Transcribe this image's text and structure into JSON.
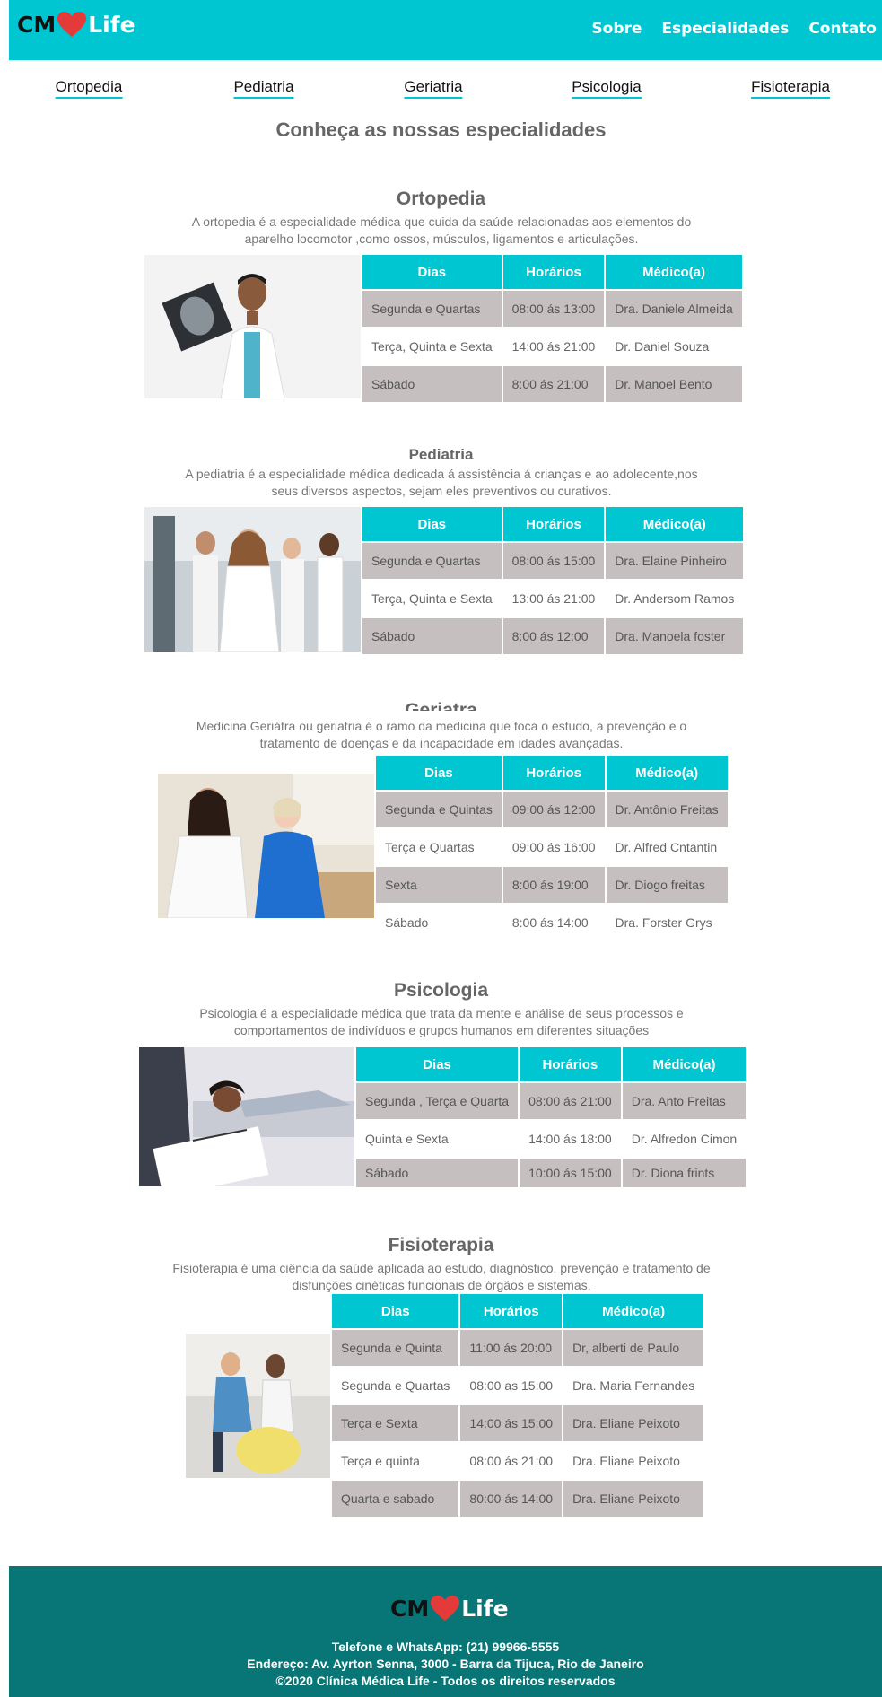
{
  "brand": {
    "cm": "CM",
    "life": "Life",
    "heart_color": "#e53a3a"
  },
  "colors": {
    "accent": "#00c6d2",
    "footer_bg": "#087676",
    "row_gray": "#c6bfbf"
  },
  "nav": {
    "sobre": "Sobre",
    "especialidades": "Especialidades",
    "contato": "Contato"
  },
  "categories": [
    "Ortopedia",
    "Pediatria",
    "Geriatria",
    "Psicologia",
    "Fisioterapia"
  ],
  "main_heading": "Conheça as nossas especialidades",
  "table_headers": {
    "dias": "Dias",
    "horarios": "Horários",
    "medico": "Médico(a)"
  },
  "sections": [
    {
      "title": "Ortopedia",
      "description": "A ortopedia é a especialidade médica que cuida da saúde relacionadas aos elementos do aparelho locomotor ,como ossos, músculos, ligamentos e articulações.",
      "photo": "doctor-holding-xray",
      "rows": [
        [
          "Segunda e Quartas",
          "08:00 ás 13:00",
          "Dra. Daniele Almeida"
        ],
        [
          "Terça, Quinta e Sexta",
          "14:00 ás 21:00",
          "Dr. Daniel Souza"
        ],
        [
          "Sábado",
          "8:00 ás 21:00",
          "Dr. Manoel Bento"
        ]
      ]
    },
    {
      "title": "Pediatria",
      "description": "A pediatria é a especialidade médica dedicada á assistência á crianças e ao adolecente,nos seus diversos aspectos, sejam eles preventivos ou curativos.",
      "photo": "team-of-doctors",
      "rows": [
        [
          "Segunda e Quartas",
          "08:00 ás 15:00",
          "Dra. Elaine Pinheiro"
        ],
        [
          "Terça, Quinta e Sexta",
          "13:00 ás 21:00",
          "Dr. Andersom Ramos"
        ],
        [
          "Sábado",
          "8:00 ás 12:00",
          "Dra. Manoela foster"
        ]
      ]
    },
    {
      "title": "Geriatra",
      "description": "Medicina Geriátra ou geriatria é o ramo da medicina que foca o estudo, a prevenção e o tratamento de doenças e da incapacidade em idades avançadas.",
      "photo": "doctor-with-elderly-woman",
      "rows": [
        [
          "Segunda e Quintas",
          "09:00 ás 12:00",
          "Dr. Antônio Freitas"
        ],
        [
          "Terça e Quartas",
          "09:00 ás 16:00",
          "Dr. Alfred Cntantin"
        ],
        [
          "Sexta",
          "8:00 ás 19:00",
          "Dr. Diogo freitas"
        ],
        [
          "Sábado",
          "8:00 ás 14:00",
          "Dra. Forster Grys"
        ]
      ]
    },
    {
      "title": "Psicologia",
      "description": "Psicologia é a especialidade médica que trata da mente e análise de seus processos e comportamentos de indivíduos e grupos humanos em diferentes situações",
      "photo": "therapy-session",
      "rows": [
        [
          "Segunda , Terça e Quarta",
          "08:00 ás 21:00",
          "Dra. Anto Freitas"
        ],
        [
          "Quinta e Sexta",
          "14:00 ás 18:00",
          "Dr. Alfredon Cimon"
        ],
        [
          "Sábado",
          "10:00 ás 15:00",
          "Dr. Diona frints"
        ]
      ]
    },
    {
      "title": "Fisioterapia",
      "description": "Fisioterapia é uma ciência da saúde aplicada ao estudo, diagnóstico, prevenção e tratamento de disfunções cinéticas funcionais de órgãos e sistemas.",
      "photo": "physiotherapy-ball",
      "rows": [
        [
          "Segunda e Quinta",
          "11:00 ás 20:00",
          "Dr, alberti de Paulo"
        ],
        [
          "Segunda e Quartas",
          "08:00 as 15:00",
          "Dra. Maria Fernandes"
        ],
        [
          "Terça e Sexta",
          "14:00 ás 15:00",
          "Dra. Eliane Peixoto"
        ],
        [
          "Terça e quinta",
          "08:00 ás 21:00",
          "Dra. Eliane Peixoto"
        ],
        [
          "Quarta e sabado",
          "80:00 ás 14:00",
          "Dra. Eliane Peixoto"
        ]
      ]
    }
  ],
  "footer": {
    "phone": "Telefone e WhatsApp: (21) 99966-5555",
    "address": "Endereço: Av. Ayrton Senna, 3000 - Barra da Tijuca, Rio de Janeiro",
    "copyright": "©2020 Clínica Médica Life - Todos os direitos reservados"
  }
}
